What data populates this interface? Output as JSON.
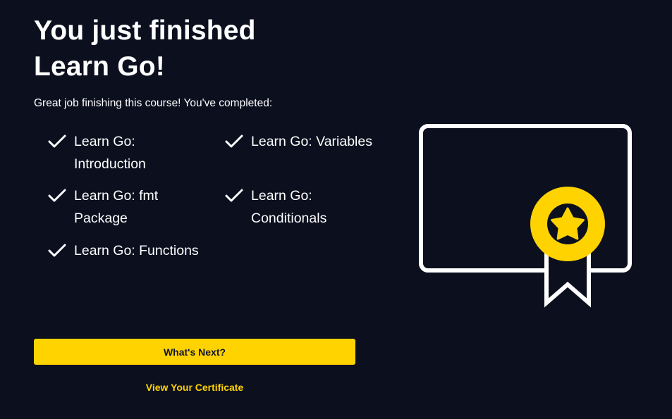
{
  "heading": {
    "line1": "You just finished",
    "line2": "Learn Go!"
  },
  "subtitle": "Great job finishing this course! You've completed:",
  "lessons": [
    {
      "label": "Learn Go: Introduction"
    },
    {
      "label": "Learn Go: Variables"
    },
    {
      "label": "Learn Go: fmt Package"
    },
    {
      "label": "Learn Go: Conditionals"
    },
    {
      "label": "Learn Go: Functions"
    }
  ],
  "icons": {
    "check": "checkmark-icon",
    "certificate": "certificate-ribbon-icon"
  },
  "actions": {
    "primary_label": "What's Next?",
    "secondary_label": "View Your Certificate"
  },
  "colors": {
    "background": "#0b0f1e",
    "accent": "#ffd300",
    "text": "#ffffff",
    "button_text": "#10162f"
  }
}
